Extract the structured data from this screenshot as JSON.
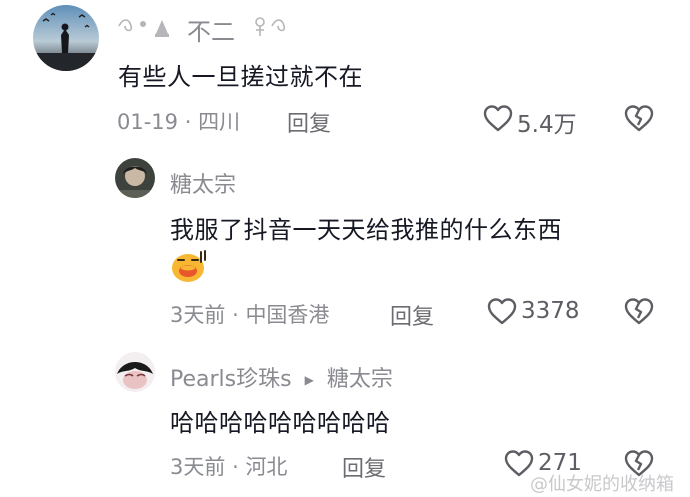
{
  "comments": [
    {
      "username": "不二",
      "text": "有些人一旦搓过就不在",
      "date": "01-19",
      "location": "四川",
      "reply_label": "回复",
      "likes": "5.4万"
    },
    {
      "username": "糖太宗",
      "text": "我服了抖音一天天给我推的什么东西",
      "emoji": "face-with-tear-emoji",
      "date": "3天前",
      "location": "中国香港",
      "reply_label": "回复",
      "likes": "3378"
    },
    {
      "username": "Pearls珍珠s",
      "reply_to": "糖太宗",
      "text": "哈哈哈哈哈哈哈哈哈",
      "date": "3天前",
      "location": "河北",
      "reply_label": "回复",
      "likes": "271"
    }
  ],
  "watermark": "@仙女妮的收纳箱",
  "separator": "·",
  "reply_arrow": "▶",
  "colors": {
    "text": "#161823",
    "meta": "#8a8b91",
    "icon": "#5d5e63"
  }
}
